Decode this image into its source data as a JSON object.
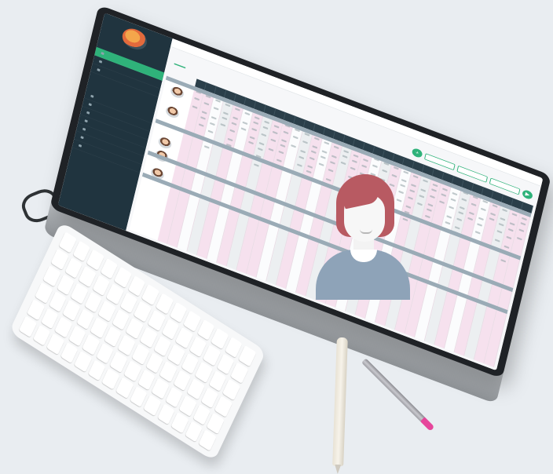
{
  "scene": {
    "background_color": "#e9edf1",
    "objects": [
      "monitor",
      "eyeglasses",
      "keyboard",
      "pen",
      "pencil"
    ]
  },
  "screen_app": {
    "accent_color": "#2fb27a",
    "sidebar_color": "#20343f",
    "header_color": "#2b3f4a",
    "schedule_columns": 34,
    "highlight_color": "#f6e1ee"
  },
  "character": {
    "hair_color": "#b85a62",
    "shirt_color": "#8ea3b8"
  },
  "pencil": {
    "cap_color": "#e6459b"
  }
}
